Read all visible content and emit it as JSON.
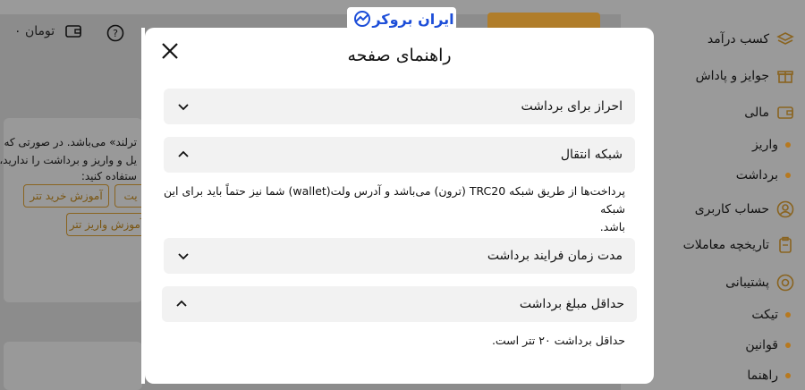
{
  "header": {
    "logo_text": "ایران بروکر",
    "balance": "۰ تومان"
  },
  "sidebar": {
    "items": [
      {
        "label": "کسب درآمد",
        "icon": "layers-icon"
      },
      {
        "label": "جوایز و پاداش",
        "icon": "gift-icon"
      },
      {
        "label": "مالی",
        "icon": "wallet-icon"
      },
      {
        "label": "واریز",
        "icon": "dot"
      },
      {
        "label": "برداشت",
        "icon": "dot"
      },
      {
        "label": "حساب کاربری",
        "icon": "user-icon"
      },
      {
        "label": "تاریخچه معاملات",
        "icon": "clipboard-icon"
      },
      {
        "label": "پشتیبانی",
        "icon": "lifebuoy-icon"
      },
      {
        "label": "تیکت",
        "icon": "dot"
      },
      {
        "label": "قوانین",
        "icon": "dot"
      },
      {
        "label": "راهنما",
        "icon": "dot"
      }
    ]
  },
  "left_card": {
    "line1": "ترلند» می‌باشد. در صورتی که",
    "line2": "یل و واریز و برداشت را ندارید،",
    "line3": "ستفاده کنید:",
    "btn_buy": "آموزش خرید تتر",
    "btn_partial": "یت",
    "btn_deposit": "آموزش واریز تتر"
  },
  "modal": {
    "title": "راهنمای صفحه",
    "sections": [
      {
        "label": "احراز برای برداشت",
        "expanded": false
      },
      {
        "label": "شبکه انتقال",
        "expanded": true,
        "content_line1": "پرداخت‌ها از طریق شبکه TRC20 (ترون) می‌باشد و آدرس ولت(wallet) شما نیز حتماً باید برای این شبکه",
        "content_line2": "باشد."
      },
      {
        "label": "مدت زمان فرایند برداشت",
        "expanded": false
      },
      {
        "label": "حداقل مبلغ برداشت",
        "expanded": true,
        "content_line1": "حداقل برداشت ۲۰ تتر است."
      }
    ]
  },
  "colors": {
    "accent": "#b7791f",
    "overlay": "#8c8c8c",
    "brand": "#1d4ed8"
  }
}
